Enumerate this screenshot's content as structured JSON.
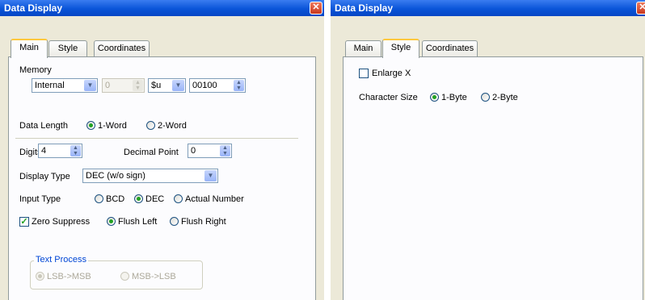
{
  "left_window": {
    "title": "Data Display",
    "tabs": [
      "Main",
      "Style",
      "Coordinates"
    ],
    "memory": {
      "label": "Memory",
      "device": "Internal",
      "device_no": "0",
      "type": "$u",
      "address": "00100"
    },
    "data_length": {
      "label": "Data Length",
      "option1": "1-Word",
      "option2": "2-Word",
      "selected": "1-Word"
    },
    "digits": {
      "label": "Digits",
      "value": "4"
    },
    "decimal_point": {
      "label": "Decimal Point",
      "value": "0"
    },
    "display_type": {
      "label": "Display Type",
      "value": "DEC (w/o sign)"
    },
    "input_type": {
      "label": "Input Type",
      "option1": "BCD",
      "option2": "DEC",
      "option3": "Actual Number",
      "selected": "DEC"
    },
    "zero_suppress": {
      "label": "Zero Suppress",
      "checked": true
    },
    "flush": {
      "option1": "Flush Left",
      "option2": "Flush Right",
      "selected": "Flush Left"
    },
    "text_process": {
      "label": "Text Process",
      "option1": "LSB->MSB",
      "option2": "MSB->LSB",
      "selected": "LSB->MSB"
    }
  },
  "right_window": {
    "title": "Data Display",
    "tabs": [
      "Main",
      "Style",
      "Coordinates"
    ],
    "enlarge_x": {
      "label": "Enlarge X",
      "checked": false
    },
    "character_size": {
      "label": "Character Size",
      "option1": "1-Byte",
      "option2": "2-Byte",
      "selected": "1-Byte"
    }
  }
}
